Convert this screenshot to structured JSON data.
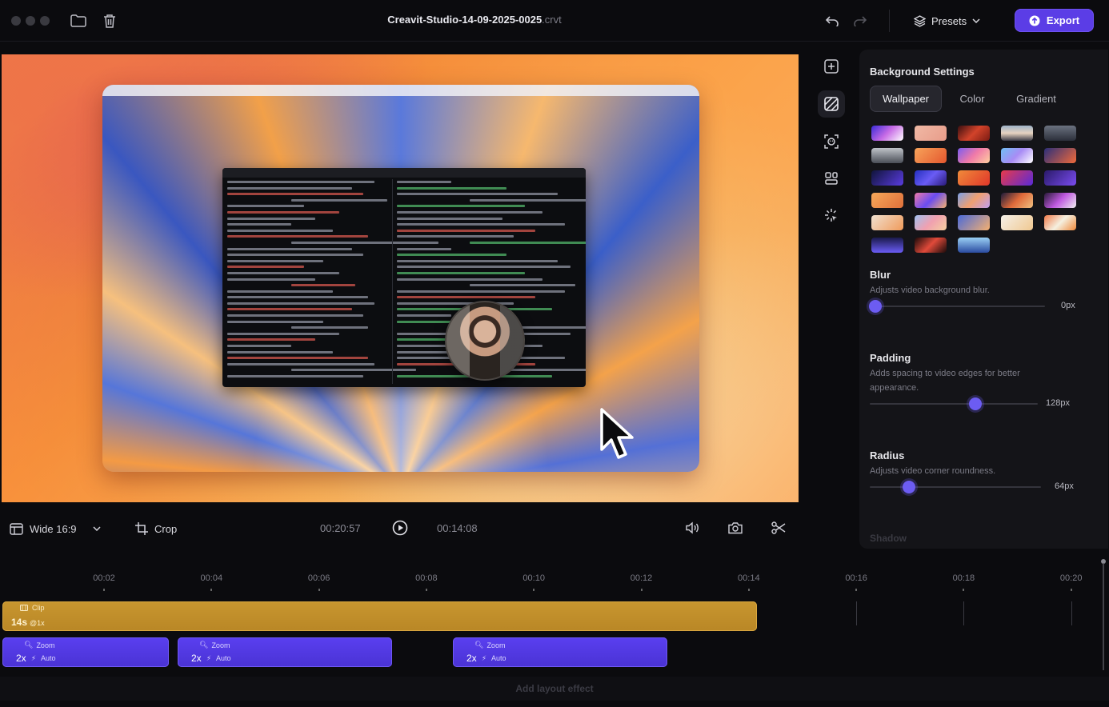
{
  "titlebar": {
    "project_name": "Creavit-Studio-14-09-2025-0025",
    "extension": ".crvt",
    "presets_label": "Presets",
    "export_label": "Export"
  },
  "panel": {
    "title": "Background Settings",
    "tabs": [
      "Wallpaper",
      "Color",
      "Gradient"
    ],
    "active_tab": "Wallpaper",
    "blur": {
      "title": "Blur",
      "desc": "Adjusts video background blur.",
      "value": "0px",
      "level": 0.0
    },
    "padding": {
      "title": "Padding",
      "desc": "Adds spacing to video edges for better appearance.",
      "value": "128px",
      "level": 0.63
    },
    "radius": {
      "title": "Radius",
      "desc": "Adjusts video corner roundness.",
      "value": "64px",
      "level": 0.23
    },
    "shadow_title": "Shadow",
    "accent": "#6c5cf2"
  },
  "controls": {
    "aspect_label": "Wide 16:9",
    "crop_label": "Crop",
    "current_time": "00:20:57",
    "total_time": "00:14:08"
  },
  "timeline": {
    "ruler": [
      "00:02",
      "00:04",
      "00:06",
      "00:08",
      "00:10",
      "00:12",
      "00:14",
      "00:16",
      "00:18",
      "00:20"
    ],
    "clip": {
      "name": "Clip",
      "duration": "14s",
      "speed": "@1x"
    },
    "zooms": [
      {
        "name": "Zoom",
        "factor": "2x",
        "mode": "Auto"
      },
      {
        "name": "Zoom",
        "factor": "2x",
        "mode": "Auto"
      },
      {
        "name": "Zoom",
        "factor": "2x",
        "mode": "Auto"
      }
    ],
    "add_layout_label": "Add layout effect"
  }
}
